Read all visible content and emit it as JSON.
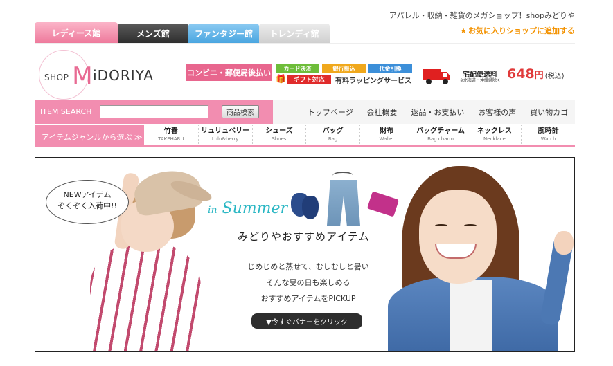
{
  "header": {
    "tagline": "アパレル・収納・雑貨のメガショップ！shopみどりや",
    "favorite_link": "お気に入りショップに追加する"
  },
  "tabs": [
    {
      "label": "レディース館"
    },
    {
      "label": "メンズ館"
    },
    {
      "label": "ファンタジー館"
    },
    {
      "label": "トレンディ館"
    }
  ],
  "logo": {
    "shop": "SHOP",
    "m": "M",
    "rest": "iDORIYA"
  },
  "services": {
    "conveni": "コンビニ・郵便局後払い",
    "card": "カード決済",
    "bank": "銀行振込",
    "cod": "代金引換",
    "gift": "ギフト対応",
    "wrapping": "有料ラッピングサービス"
  },
  "delivery": {
    "title": "宅配便送料",
    "note": "※北海道・沖縄県除く",
    "price": "648",
    "unit": "円",
    "tax": "(税込)"
  },
  "search": {
    "label": "ITEM SEARCH",
    "value": "",
    "button": "商品検索"
  },
  "topnav": [
    "トップページ",
    "会社概要",
    "返品・お支払い",
    "お客様の声",
    "買い物カゴ"
  ],
  "genre": {
    "label": "アイテムジャンルから選ぶ ≫",
    "items": [
      {
        "ja": "竹春",
        "en": "TAKEHARU"
      },
      {
        "ja": "リュリュベリー",
        "en": "Lulu&berry"
      },
      {
        "ja": "シューズ",
        "en": "Shoes"
      },
      {
        "ja": "バッグ",
        "en": "Bag"
      },
      {
        "ja": "財布",
        "en": "Wallet"
      },
      {
        "ja": "バッグチャーム",
        "en": "Bag charm"
      },
      {
        "ja": "ネックレス",
        "en": "Necklace"
      },
      {
        "ja": "腕時計",
        "en": "Watch"
      }
    ]
  },
  "banner": {
    "bubble_line1": "NEWアイテム",
    "bubble_line2": "ぞくぞく入荷中!!",
    "summer_in": "in",
    "summer": "Summer",
    "heading": "みどりやおすすめアイテム",
    "copy1": "じめじめと蒸せて、むしむしと暑い",
    "copy2": "そんな夏の日も楽しめる",
    "copy3": "おすすめアイテムをPICKUP",
    "cta": "▼今すぐバナーをクリック"
  },
  "colors": {
    "pink": "#f28db0",
    "brand_pink": "#e86a93",
    "accent_orange": "#f39200",
    "price_red": "#e03a3a"
  }
}
